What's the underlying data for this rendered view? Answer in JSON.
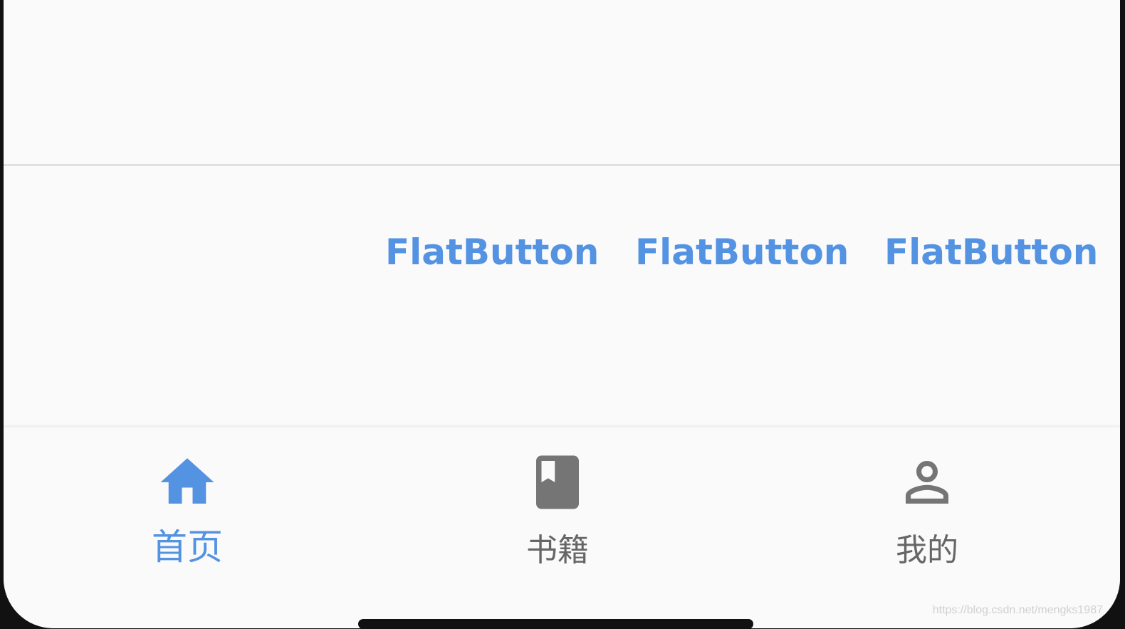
{
  "content": {
    "flat_buttons": [
      {
        "label": "FlatButton"
      },
      {
        "label": "FlatButton"
      },
      {
        "label": "FlatButton"
      }
    ]
  },
  "bottom_nav": {
    "items": [
      {
        "label": "首页",
        "icon": "home-icon",
        "selected": true
      },
      {
        "label": "书籍",
        "icon": "book-icon",
        "selected": false
      },
      {
        "label": "我的",
        "icon": "person-icon",
        "selected": false
      }
    ]
  },
  "colors": {
    "accent": "#5492E2",
    "inactive": "#666666",
    "background": "#FAFAFA",
    "divider": "#E0E0E0"
  },
  "watermark": "https://blog.csdn.net/mengks1987"
}
